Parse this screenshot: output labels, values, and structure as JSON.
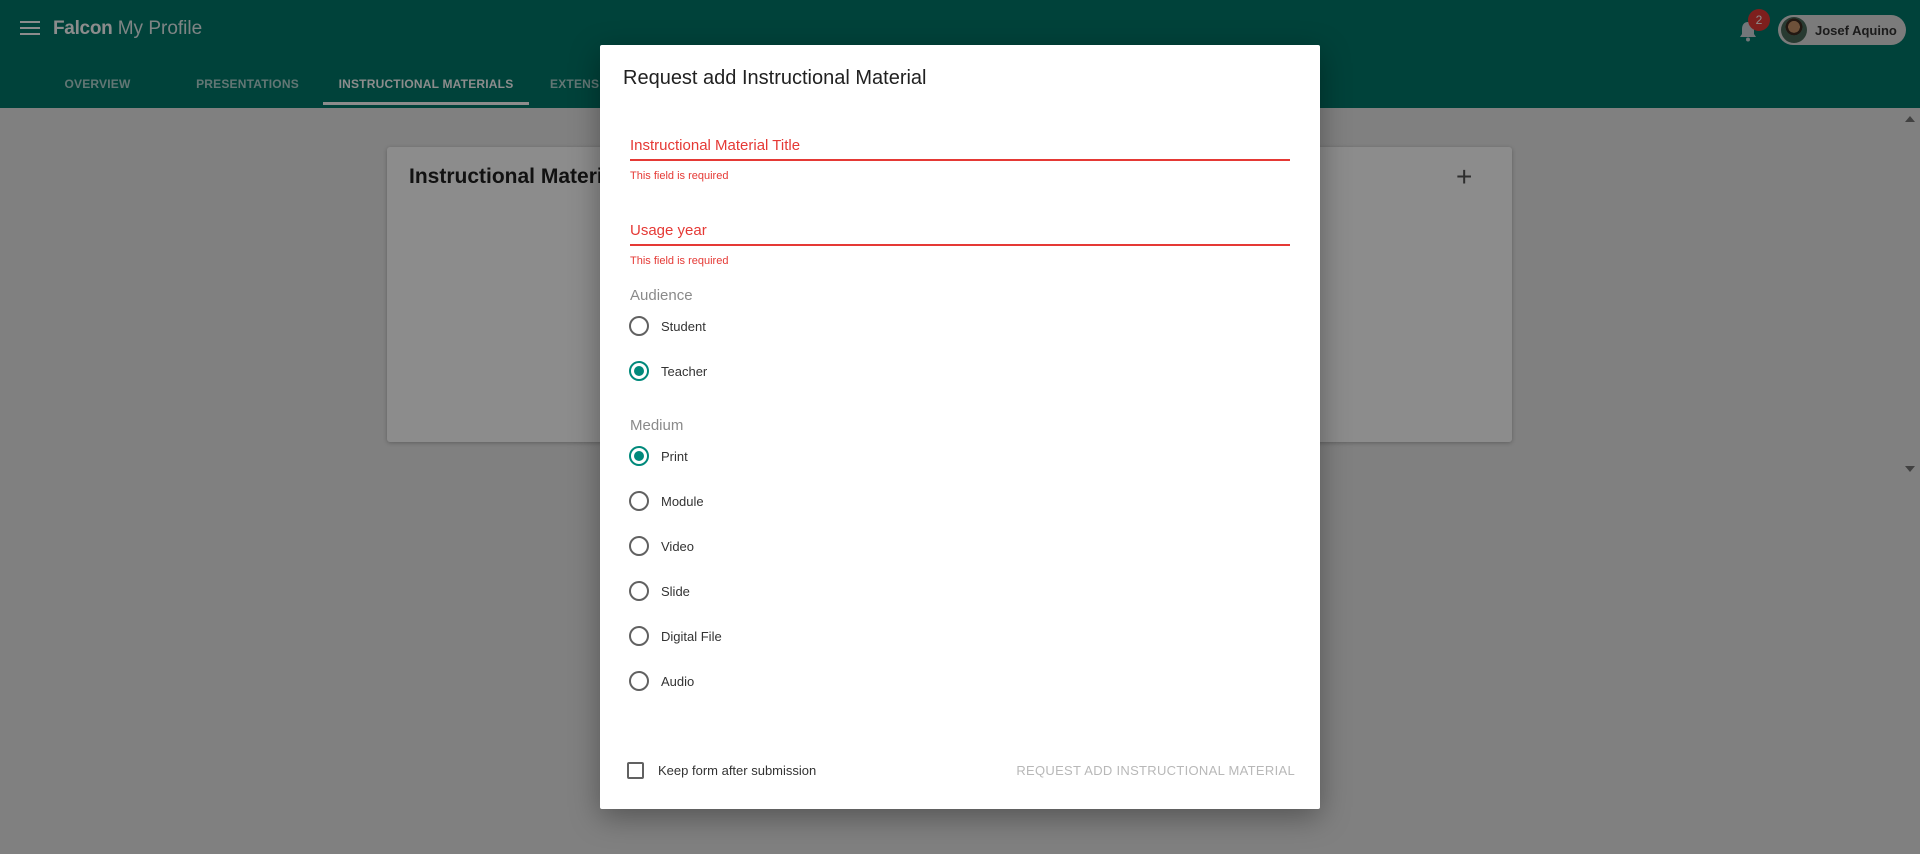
{
  "app": {
    "brand_bold": "Falcon",
    "brand_light": "My Profile",
    "notification_count": "2",
    "user_name": "Josef Aquino"
  },
  "tabs": [
    {
      "label": "OVERVIEW",
      "active": false
    },
    {
      "label": "PRESENTATIONS",
      "active": false
    },
    {
      "label": "INSTRUCTIONAL MATERIALS",
      "active": true
    },
    {
      "label": "EXTENSI",
      "active": false
    }
  ],
  "page": {
    "card_title": "Instructional Materials",
    "add_icon": "+"
  },
  "dialog": {
    "title": "Request add Instructional Material",
    "title_field": {
      "label": "Instructional Material Title",
      "error": "This field is required",
      "value": ""
    },
    "year_field": {
      "label": "Usage year",
      "error": "This field is required",
      "value": ""
    },
    "audience": {
      "label": "Audience",
      "options": [
        "Student",
        "Teacher"
      ],
      "selected": "Teacher"
    },
    "medium": {
      "label": "Medium",
      "options": [
        "Print",
        "Module",
        "Video",
        "Slide",
        "Digital File",
        "Audio"
      ],
      "selected": "Print"
    },
    "keep_form_label": "Keep form after submission",
    "keep_form_checked": false,
    "submit_label": "REQUEST ADD INSTRUCTIONAL MATERIAL"
  },
  "colors": {
    "primary": "#00796b",
    "accent": "#00897b",
    "error": "#e53935",
    "badge": "#e53935"
  }
}
